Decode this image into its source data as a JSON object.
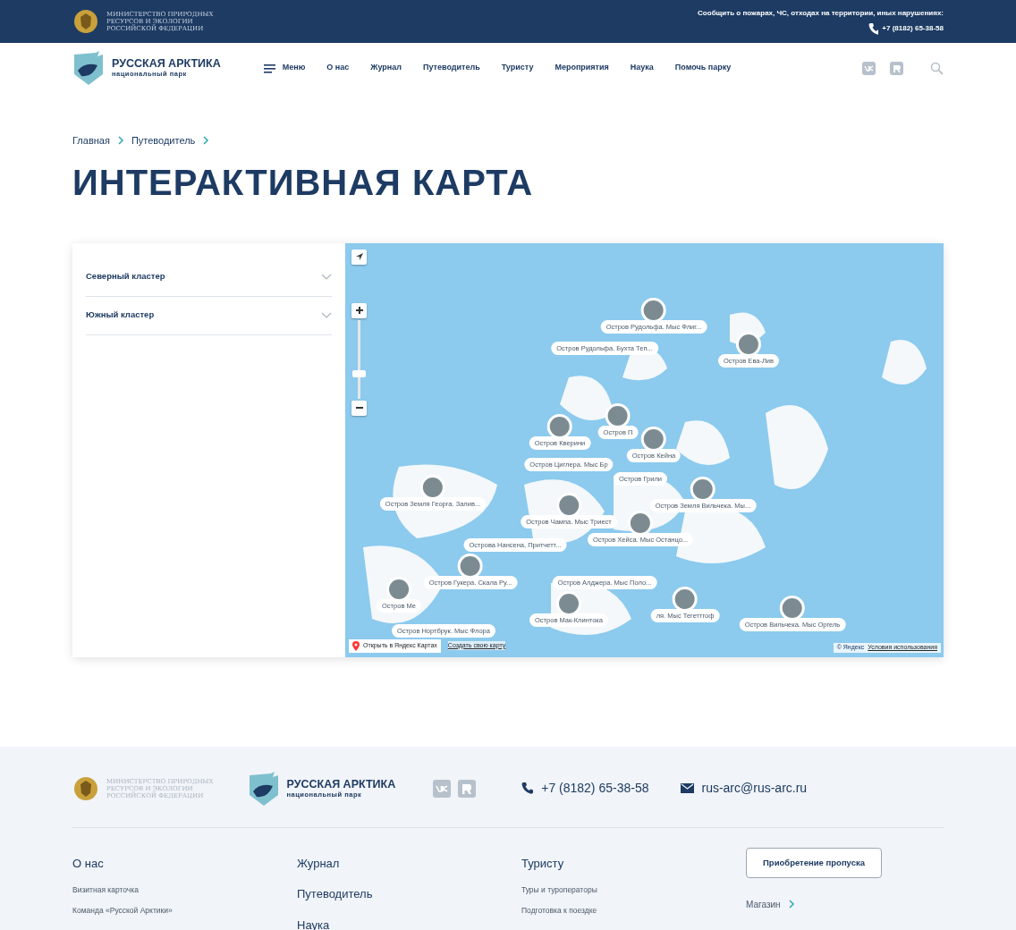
{
  "top_bar": {
    "ministry_lines": [
      "МИНИСТЕРСТВО ПРИРОДНЫХ",
      "РЕСУРСОВ И ЭКОЛОГИИ",
      "РОССИЙСКОЙ ФЕДЕРАЦИИ"
    ],
    "report": "Сообщить о пожарах, ЧС, отходах на территории, иных нарушениях:",
    "phone": "+7 (8182) 65-38-58"
  },
  "header": {
    "logo_title": "РУССКАЯ АРКТИКА",
    "logo_subtitle": "национальный парк",
    "menu_button": "Меню",
    "nav": [
      "О нас",
      "Журнал",
      "Путеводитель",
      "Туристу",
      "Мероприятия",
      "Наука",
      "Помочь парку"
    ]
  },
  "breadcrumbs": [
    "Главная",
    "Путеводитель"
  ],
  "title": "ИНТЕРАКТИВНАЯ КАРТА",
  "sidebar": {
    "clusters": [
      {
        "label": "Северный кластер",
        "expanded": false
      },
      {
        "label": "Южный кластер",
        "expanded": false
      }
    ]
  },
  "map": {
    "markers": [
      {
        "label": "Остров Рудольфа. Мыс Флиг..."
      },
      {
        "label": "Остров Рудольфа. Бухта Теп..."
      },
      {
        "label": "Остров Ева-Лив"
      },
      {
        "label": "Остров П"
      },
      {
        "label": "Остров Кверини"
      },
      {
        "label": "Остров Циглера. Мыс Бр"
      },
      {
        "label": "Остров Кейна"
      },
      {
        "label": "Остров Грили"
      },
      {
        "label": "Остров Земля Георга. Залив..."
      },
      {
        "label": "Остров Земля Вильчека. Мы..."
      },
      {
        "label": "Остров Чампа. Мыс Триест"
      },
      {
        "label": "Острова Нансена, Притчетт..."
      },
      {
        "label": "Остров Хейса. Мыс Останцо..."
      },
      {
        "label": "Остров Гукера. Скала Ру..."
      },
      {
        "label": "Остров Алджера. Мыс Поло..."
      },
      {
        "label": "Остров Мак-Клинтока"
      },
      {
        "label": "ля. Мыс Тегеттгоф"
      },
      {
        "label": "Остров Ме"
      },
      {
        "label": "Остров Нортбрук. Мыс Флора"
      },
      {
        "label": "Остров Вильчека. Мыс Оргель"
      }
    ],
    "open_link": "Открыть в Яндекс Картах",
    "create_link": "Создать свою карту",
    "copyright": "© Яндекс",
    "terms": "Условия использования"
  },
  "footer": {
    "ministry_lines": [
      "МИНИСТЕРСТВО ПРИРОДНЫХ",
      "РЕСУРСОВ И ЭКОЛОГИИ",
      "РОССИЙСКОЙ ФЕДЕРАЦИИ"
    ],
    "logo_title": "РУССКАЯ АРКТИКА",
    "logo_subtitle": "национальный парк",
    "phone": "+7 (8182) 65-38-58",
    "email": "rus-arc@rus-arc.ru",
    "columns": [
      {
        "heading": "О нас",
        "links": [
          "Визитная карточка",
          "Команда «Русской Арктики»"
        ]
      },
      {
        "big_links": [
          "Журнал",
          "Путеводитель",
          "Наука"
        ]
      },
      {
        "heading": "Туристу",
        "links": [
          "Туры и туроператоры",
          "Подготовка к поездке"
        ]
      }
    ],
    "pass_button": "Приобретение пропуска",
    "shop_link": "Магазин"
  }
}
